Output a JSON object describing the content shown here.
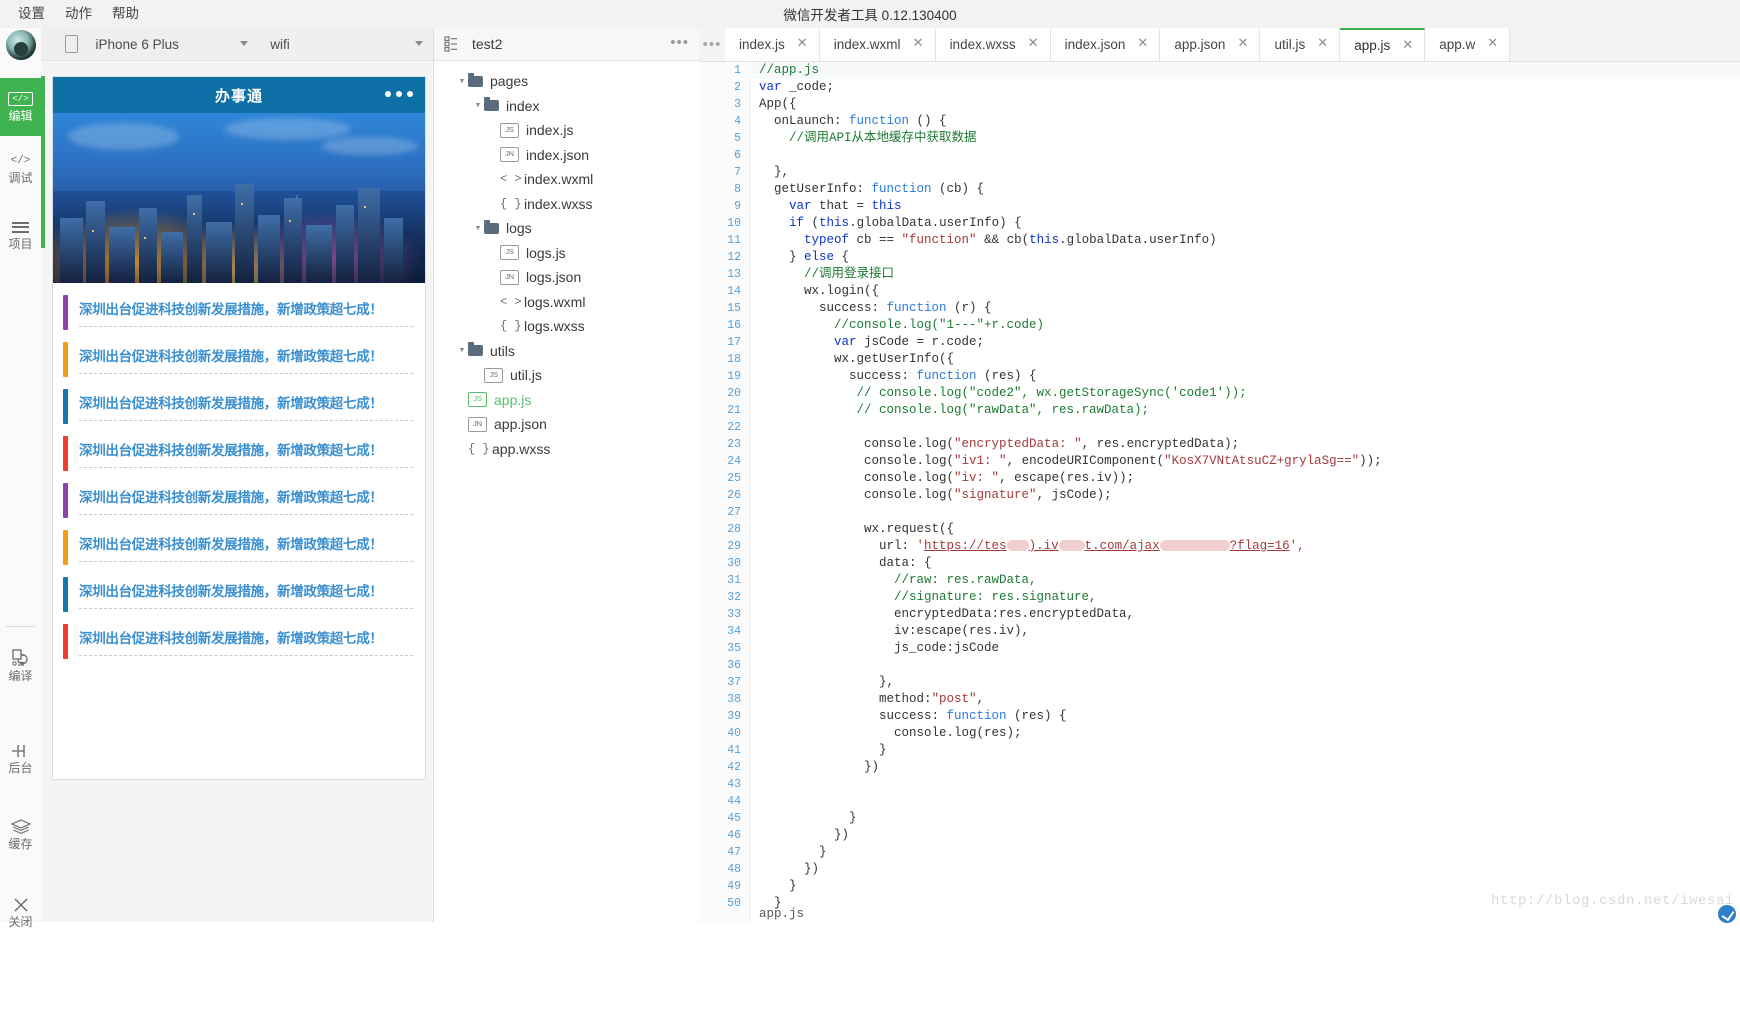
{
  "window": {
    "title": "微信开发者工具 0.12.130400",
    "menu": [
      "设置",
      "动作",
      "帮助"
    ]
  },
  "rail": {
    "avatar": "user-avatar",
    "items": [
      {
        "label": "编辑",
        "icon": "code-brackets-icon",
        "glyph": "</>",
        "active": true
      },
      {
        "label": "调试",
        "icon": "code-brackets-icon",
        "glyph": "</>",
        "active": false
      },
      {
        "label": "项目",
        "icon": "stack-lines-icon",
        "glyph": "",
        "active": false
      }
    ],
    "bottom_items": [
      {
        "label": "编译",
        "icon": "compile-icon"
      },
      {
        "label": "后台",
        "icon": "background-icon"
      },
      {
        "label": "缓存",
        "icon": "cache-layers-icon"
      },
      {
        "label": "关闭",
        "icon": "close-x-icon"
      }
    ]
  },
  "simulator": {
    "device": "iPhone 6 Plus",
    "network": "wifi",
    "phone_icon": "phone-outline-icon",
    "navbar_title": "办事通",
    "menu_dots": "three-dots-icon",
    "news": [
      {
        "text": "深圳出台促进科技创新发展措施，新增政策超七成！",
        "color": "#8e44ad"
      },
      {
        "text": "深圳出台促进科技创新发展措施，新增政策超七成！",
        "color": "#f39c12"
      },
      {
        "text": "深圳出台促进科技创新发展措施，新增政策超七成！",
        "color": "#1279ab"
      },
      {
        "text": "深圳出台促进科技创新发展措施，新增政策超七成！",
        "color": "#f03b2e"
      },
      {
        "text": "深圳出台促进科技创新发展措施，新增政策超七成！",
        "color": "#8e44ad"
      },
      {
        "text": "深圳出台促进科技创新发展措施，新增政策超七成！",
        "color": "#f39c12"
      },
      {
        "text": "深圳出台促进科技创新发展措施，新增政策超七成！",
        "color": "#1279ab"
      },
      {
        "text": "深圳出台促进科技创新发展措施，新增政策超七成！",
        "color": "#f03b2e"
      }
    ]
  },
  "tree": {
    "project_icon": "project-structure-icon",
    "project_name": "test2",
    "more_icon": "ellipsis-icon",
    "nodes": [
      {
        "name": "pages",
        "indent": 1,
        "type": "folder",
        "tag": "",
        "expanded": true,
        "selected": false
      },
      {
        "name": "index",
        "indent": 2,
        "type": "folder",
        "tag": "",
        "expanded": true,
        "selected": false
      },
      {
        "name": "index.js",
        "indent": 3,
        "type": "tag",
        "tag": "JS",
        "expanded": null,
        "selected": false
      },
      {
        "name": "index.json",
        "indent": 3,
        "type": "tag",
        "tag": "JN",
        "expanded": null,
        "selected": false
      },
      {
        "name": "index.wxml",
        "indent": 3,
        "type": "sym",
        "tag": "< >",
        "expanded": null,
        "selected": false
      },
      {
        "name": "index.wxss",
        "indent": 3,
        "type": "sym",
        "tag": "{ }",
        "expanded": null,
        "selected": false
      },
      {
        "name": "logs",
        "indent": 2,
        "type": "folder",
        "tag": "",
        "expanded": true,
        "selected": false
      },
      {
        "name": "logs.js",
        "indent": 3,
        "type": "tag",
        "tag": "JS",
        "expanded": null,
        "selected": false
      },
      {
        "name": "logs.json",
        "indent": 3,
        "type": "tag",
        "tag": "JN",
        "expanded": null,
        "selected": false
      },
      {
        "name": "logs.wxml",
        "indent": 3,
        "type": "sym",
        "tag": "< >",
        "expanded": null,
        "selected": false
      },
      {
        "name": "logs.wxss",
        "indent": 3,
        "type": "sym",
        "tag": "{ }",
        "expanded": null,
        "selected": false
      },
      {
        "name": "utils",
        "indent": 1,
        "type": "folder",
        "tag": "",
        "expanded": true,
        "selected": false
      },
      {
        "name": "util.js",
        "indent": 2,
        "type": "tag",
        "tag": "JS",
        "expanded": null,
        "selected": false
      },
      {
        "name": "app.js",
        "indent": 1,
        "type": "tag",
        "tag": "JS",
        "expanded": null,
        "selected": true
      },
      {
        "name": "app.json",
        "indent": 1,
        "type": "tag",
        "tag": "JN",
        "expanded": null,
        "selected": false
      },
      {
        "name": "app.wxss",
        "indent": 1,
        "type": "sym",
        "tag": "{ }",
        "expanded": null,
        "selected": false
      }
    ]
  },
  "editor": {
    "tabs_more_icon": "ellipsis-icon",
    "tabs": [
      {
        "label": "index.js",
        "active": false
      },
      {
        "label": "index.wxml",
        "active": false
      },
      {
        "label": "index.wxss",
        "active": false
      },
      {
        "label": "index.json",
        "active": false
      },
      {
        "label": "app.json",
        "active": false
      },
      {
        "label": "util.js",
        "active": false
      },
      {
        "label": "app.js",
        "active": true
      },
      {
        "label": "app.w",
        "active": false
      }
    ],
    "close_icon": "close-x-icon",
    "bottom_label": "app.js",
    "watermark": "http://blog.csdn.net/iwesai",
    "first_line_number": 1,
    "last_line_number": 50,
    "code": [
      {
        "n": 1,
        "tokens": [
          {
            "t": "//app.js",
            "c": "cm"
          }
        ]
      },
      {
        "n": 2,
        "tokens": [
          {
            "t": "var ",
            "c": "kw"
          },
          {
            "t": "_code;",
            "c": ""
          }
        ]
      },
      {
        "n": 3,
        "tokens": [
          {
            "t": "App({",
            "c": ""
          }
        ]
      },
      {
        "n": 4,
        "tokens": [
          {
            "t": "  onLaunch: ",
            "c": ""
          },
          {
            "t": "function",
            "c": "fn"
          },
          {
            "t": " () {",
            "c": ""
          }
        ]
      },
      {
        "n": 5,
        "tokens": [
          {
            "t": "    //调用API从本地缓存中获取数据",
            "c": "cm"
          }
        ]
      },
      {
        "n": 6,
        "tokens": [
          {
            "t": "",
            "c": ""
          }
        ]
      },
      {
        "n": 7,
        "tokens": [
          {
            "t": "  },",
            "c": ""
          }
        ]
      },
      {
        "n": 8,
        "tokens": [
          {
            "t": "  getUserInfo: ",
            "c": ""
          },
          {
            "t": "function",
            "c": "fn"
          },
          {
            "t": " (cb) {",
            "c": ""
          }
        ]
      },
      {
        "n": 9,
        "tokens": [
          {
            "t": "    ",
            "c": ""
          },
          {
            "t": "var",
            "c": "kw"
          },
          {
            "t": " that = ",
            "c": ""
          },
          {
            "t": "this",
            "c": "th"
          }
        ]
      },
      {
        "n": 10,
        "tokens": [
          {
            "t": "    ",
            "c": ""
          },
          {
            "t": "if",
            "c": "kw"
          },
          {
            "t": " (",
            "c": ""
          },
          {
            "t": "this",
            "c": "th"
          },
          {
            "t": ".globalData.userInfo) {",
            "c": ""
          }
        ]
      },
      {
        "n": 11,
        "tokens": [
          {
            "t": "      ",
            "c": ""
          },
          {
            "t": "typeof",
            "c": "kw"
          },
          {
            "t": " cb == ",
            "c": ""
          },
          {
            "t": "\"function\"",
            "c": "str"
          },
          {
            "t": " && cb(",
            "c": ""
          },
          {
            "t": "this",
            "c": "th"
          },
          {
            "t": ".globalData.userInfo)",
            "c": ""
          }
        ]
      },
      {
        "n": 12,
        "tokens": [
          {
            "t": "    } ",
            "c": ""
          },
          {
            "t": "else",
            "c": "kw"
          },
          {
            "t": " {",
            "c": ""
          }
        ]
      },
      {
        "n": 13,
        "tokens": [
          {
            "t": "      //调用登录接口",
            "c": "cm"
          }
        ]
      },
      {
        "n": 14,
        "tokens": [
          {
            "t": "      wx.login({",
            "c": ""
          }
        ]
      },
      {
        "n": 15,
        "tokens": [
          {
            "t": "        success: ",
            "c": ""
          },
          {
            "t": "function",
            "c": "fn"
          },
          {
            "t": " (r) {",
            "c": ""
          }
        ]
      },
      {
        "n": 16,
        "tokens": [
          {
            "t": "          //console.log(\"1---\"+r.code)",
            "c": "cm"
          }
        ]
      },
      {
        "n": 17,
        "tokens": [
          {
            "t": "          ",
            "c": ""
          },
          {
            "t": "var",
            "c": "kw"
          },
          {
            "t": " jsCode = r.code;",
            "c": ""
          }
        ]
      },
      {
        "n": 18,
        "tokens": [
          {
            "t": "          wx.getUserInfo({",
            "c": ""
          }
        ]
      },
      {
        "n": 19,
        "tokens": [
          {
            "t": "            success: ",
            "c": ""
          },
          {
            "t": "function",
            "c": "fn"
          },
          {
            "t": " (res) {",
            "c": ""
          }
        ]
      },
      {
        "n": 20,
        "tokens": [
          {
            "t": "             // console.log(\"code2\", wx.getStorageSync('code1'));",
            "c": "cm"
          }
        ]
      },
      {
        "n": 21,
        "tokens": [
          {
            "t": "             // console.log(\"rawData\", res.rawData);",
            "c": "cm"
          }
        ]
      },
      {
        "n": 22,
        "tokens": [
          {
            "t": "",
            "c": ""
          }
        ]
      },
      {
        "n": 23,
        "tokens": [
          {
            "t": "              console.log(",
            "c": ""
          },
          {
            "t": "\"encryptedData: \"",
            "c": "str"
          },
          {
            "t": ", res.encryptedData);",
            "c": ""
          }
        ]
      },
      {
        "n": 24,
        "tokens": [
          {
            "t": "              console.log(",
            "c": ""
          },
          {
            "t": "\"iv1: \"",
            "c": "str"
          },
          {
            "t": ", encodeURIComponent(",
            "c": ""
          },
          {
            "t": "\"KosX7VNtAtsuCZ+grylaSg==\"",
            "c": "str"
          },
          {
            "t": "));",
            "c": ""
          }
        ]
      },
      {
        "n": 25,
        "tokens": [
          {
            "t": "              console.log(",
            "c": ""
          },
          {
            "t": "\"iv: \"",
            "c": "str"
          },
          {
            "t": ", escape(res.iv));",
            "c": ""
          }
        ]
      },
      {
        "n": 26,
        "tokens": [
          {
            "t": "              console.log(",
            "c": ""
          },
          {
            "t": "\"signature\"",
            "c": "str"
          },
          {
            "t": ", jsCode);",
            "c": ""
          }
        ]
      },
      {
        "n": 27,
        "tokens": [
          {
            "t": "",
            "c": ""
          }
        ]
      },
      {
        "n": 28,
        "tokens": [
          {
            "t": "              wx.request({",
            "c": ""
          }
        ]
      },
      {
        "n": 29,
        "tokens": [
          {
            "t": "__URL__",
            "c": "url"
          }
        ]
      },
      {
        "n": 30,
        "tokens": [
          {
            "t": "                data: {",
            "c": ""
          }
        ]
      },
      {
        "n": 31,
        "tokens": [
          {
            "t": "                  //raw: res.rawData,",
            "c": "cm"
          }
        ]
      },
      {
        "n": 32,
        "tokens": [
          {
            "t": "                  //signature: res.signature,",
            "c": "cm"
          }
        ]
      },
      {
        "n": 33,
        "tokens": [
          {
            "t": "                  encryptedData:res.encryptedData,",
            "c": ""
          }
        ]
      },
      {
        "n": 34,
        "tokens": [
          {
            "t": "                  iv:escape(res.iv),",
            "c": ""
          }
        ]
      },
      {
        "n": 35,
        "tokens": [
          {
            "t": "                  js_code:jsCode",
            "c": ""
          }
        ]
      },
      {
        "n": 36,
        "tokens": [
          {
            "t": "",
            "c": ""
          }
        ]
      },
      {
        "n": 37,
        "tokens": [
          {
            "t": "                },",
            "c": ""
          }
        ]
      },
      {
        "n": 38,
        "tokens": [
          {
            "t": "                method:",
            "c": ""
          },
          {
            "t": "\"post\"",
            "c": "str"
          },
          {
            "t": ",",
            "c": ""
          }
        ]
      },
      {
        "n": 39,
        "tokens": [
          {
            "t": "                success: ",
            "c": ""
          },
          {
            "t": "function",
            "c": "fn"
          },
          {
            "t": " (res) {",
            "c": ""
          }
        ]
      },
      {
        "n": 40,
        "tokens": [
          {
            "t": "                  console.log(res);",
            "c": ""
          }
        ]
      },
      {
        "n": 41,
        "tokens": [
          {
            "t": "                }",
            "c": ""
          }
        ]
      },
      {
        "n": 42,
        "tokens": [
          {
            "t": "              })",
            "c": ""
          }
        ]
      },
      {
        "n": 43,
        "tokens": [
          {
            "t": "",
            "c": ""
          }
        ]
      },
      {
        "n": 44,
        "tokens": [
          {
            "t": "",
            "c": ""
          }
        ]
      },
      {
        "n": 45,
        "tokens": [
          {
            "t": "            }",
            "c": ""
          }
        ]
      },
      {
        "n": 46,
        "tokens": [
          {
            "t": "          })",
            "c": ""
          }
        ]
      },
      {
        "n": 47,
        "tokens": [
          {
            "t": "        }",
            "c": ""
          }
        ]
      },
      {
        "n": 48,
        "tokens": [
          {
            "t": "      })",
            "c": ""
          }
        ]
      },
      {
        "n": 49,
        "tokens": [
          {
            "t": "    }",
            "c": ""
          }
        ]
      },
      {
        "n": 50,
        "tokens": [
          {
            "t": "  }",
            "c": ""
          }
        ]
      }
    ],
    "url_line": {
      "prefix": "                url: ",
      "quote_open": "'",
      "seg1": "https://tes",
      "seg2": ").iv",
      "seg3": "t.com/ajax",
      "seg4": "?flag=16",
      "quote_close": "',"
    }
  },
  "colors": {
    "accent_green": "#3eb34f",
    "nav_blue": "#0f70a8",
    "news_blue": "#3a8fd0",
    "gutter_blue": "#5a9fd4",
    "comment_green": "#1d7a32",
    "keyword_blue": "#0b35c8",
    "string_red": "#a33a3a",
    "redaction_pink": "#f2cfcf"
  }
}
